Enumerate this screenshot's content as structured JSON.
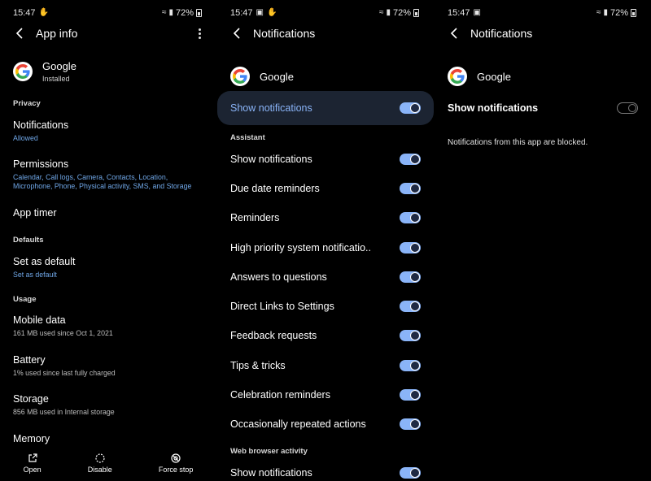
{
  "status": {
    "time": "15:47",
    "battery": "72%"
  },
  "screen1": {
    "title": "App info",
    "app_name": "Google",
    "app_status": "Installed",
    "sections": {
      "privacy": "Privacy",
      "defaults": "Defaults",
      "usage": "Usage"
    },
    "items": {
      "notifications": {
        "title": "Notifications",
        "sub": "Allowed"
      },
      "permissions": {
        "title": "Permissions",
        "sub": "Calendar, Call logs, Camera, Contacts, Location, Microphone, Phone, Physical activity, SMS, and Storage"
      },
      "app_timer": {
        "title": "App timer"
      },
      "set_default": {
        "title": "Set as default",
        "sub": "Set as default"
      },
      "mobile_data": {
        "title": "Mobile data",
        "sub": "161 MB used since Oct 1, 2021"
      },
      "battery": {
        "title": "Battery",
        "sub": "1% used since last fully charged"
      },
      "storage": {
        "title": "Storage",
        "sub": "856 MB used in Internal storage"
      },
      "memory": {
        "title": "Memory"
      }
    },
    "bottom": {
      "open": "Open",
      "disable": "Disable",
      "force_stop": "Force stop"
    }
  },
  "screen2": {
    "title": "Notifications",
    "app_name": "Google",
    "show_notifications": "Show notifications",
    "section_assistant": "Assistant",
    "assistant_items": [
      "Show notifications",
      "Due date reminders",
      "Reminders",
      "High priority system notificatio..",
      "Answers to questions",
      "Direct Links to Settings",
      "Feedback requests",
      "Tips & tricks",
      "Celebration reminders",
      "Occasionally repeated actions"
    ],
    "section_web": "Web browser activity",
    "web_items": [
      "Show notifications"
    ]
  },
  "screen3": {
    "title": "Notifications",
    "app_name": "Google",
    "show_notifications": "Show notifications",
    "blocked_text": "Notifications from this app are blocked."
  },
  "colors": {
    "accent": "#8ab4f8",
    "link": "#6fa6e6",
    "highlight_bg": "#1c2432"
  }
}
